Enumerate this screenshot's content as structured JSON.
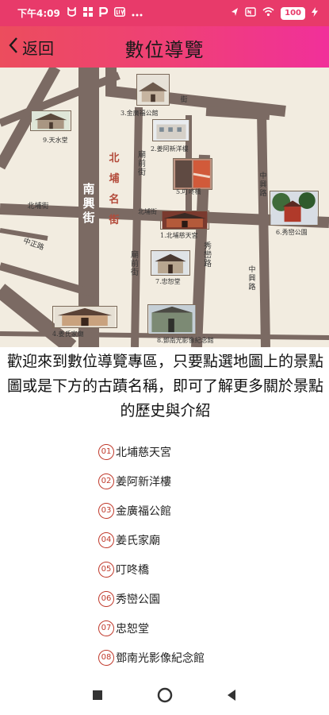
{
  "status_bar": {
    "time": "下午4:09",
    "left_icons": [
      "cat-icon",
      "grid-icon",
      "p-icon",
      "news-icon",
      "more-icon"
    ],
    "battery": "100"
  },
  "header": {
    "back_label": "返回",
    "title": "數位導覽"
  },
  "map": {
    "spots": [
      {
        "number": "1",
        "label": "1.北埔慈天宮"
      },
      {
        "number": "2",
        "label": "2.姜阿新洋樓"
      },
      {
        "number": "3",
        "label": "3.金廣福公館"
      },
      {
        "number": "4",
        "label": "4.姜氏家廟"
      },
      {
        "number": "5",
        "label": "5.叮咚橋"
      },
      {
        "number": "6",
        "label": "6.秀巒公園"
      },
      {
        "number": "7",
        "label": "7.忠恕堂"
      },
      {
        "number": "8",
        "label": "8.鄧南光影像紀念館"
      },
      {
        "number": "9",
        "label": "9.天水堂"
      }
    ],
    "streets": {
      "nanxing": "南興街",
      "beipu": "北埔街",
      "beipu_old": "北埔街",
      "miaoqian": "廟前街",
      "zhongzheng": "中正路",
      "xiuluan": "秀巒路",
      "zhongxing": "中興路",
      "zhongxing2": "中興路",
      "beipu_name_street": "北埔名街",
      "miaoqian2": "廟前街",
      "jie": "街",
      "beipu_small": "北埔街"
    }
  },
  "intro": "歡迎來到數位導覽專區，只要點選地圖上的景點圖或是下方的古蹟名稱，即可了解更多關於景點的歷史與介紹",
  "sites": [
    {
      "num": "01",
      "name": "北埔慈天宮"
    },
    {
      "num": "02",
      "name": "姜阿新洋樓"
    },
    {
      "num": "03",
      "name": "金廣福公館"
    },
    {
      "num": "04",
      "name": "姜氏家廟"
    },
    {
      "num": "05",
      "name": "叮咚橋"
    },
    {
      "num": "06",
      "name": "秀巒公園"
    },
    {
      "num": "07",
      "name": "忠恕堂"
    },
    {
      "num": "08",
      "name": "鄧南光影像紀念館"
    }
  ],
  "colors": {
    "accent": "#ec4d5d",
    "road": "#7b6a63",
    "number_ring": "#c0392b"
  }
}
